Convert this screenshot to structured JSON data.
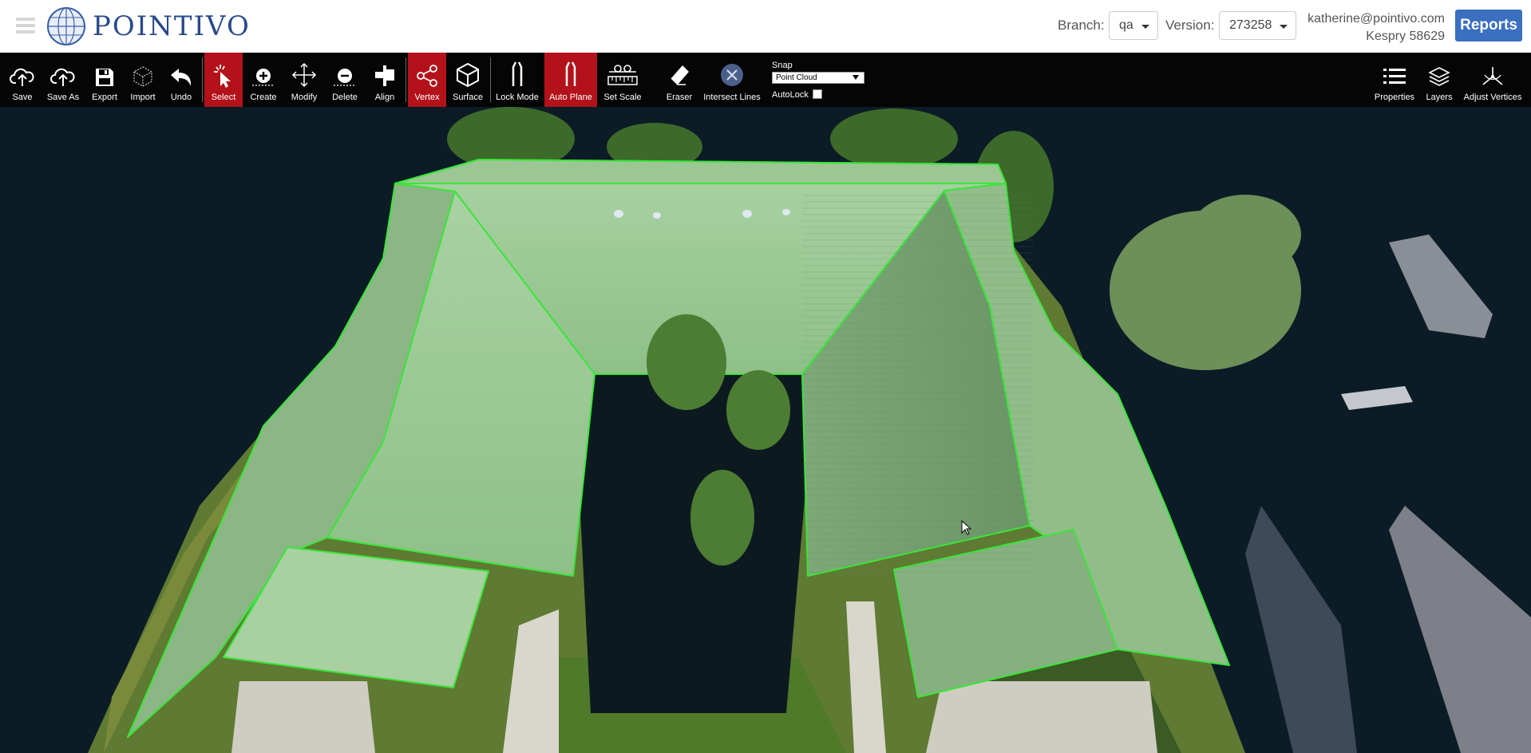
{
  "app": {
    "name": "POINTIVO"
  },
  "header": {
    "branch_label": "Branch:",
    "branch_value": "qa",
    "version_label": "Version:",
    "version_value": "273258",
    "user_email": "katherine@pointivo.com",
    "project_name": "Kespry 58629",
    "reports_label": "Reports"
  },
  "toolbar": {
    "tools": [
      {
        "id": "save",
        "label": "Save",
        "icon": "cloud-upload-icon",
        "active": false
      },
      {
        "id": "save-as",
        "label": "Save As",
        "icon": "cloud-upload-icon",
        "active": false
      },
      {
        "id": "export",
        "label": "Export",
        "icon": "floppy-disk-icon",
        "active": false
      },
      {
        "id": "import",
        "label": "Import",
        "icon": "wireframe-cube-icon",
        "active": false
      },
      {
        "id": "undo",
        "label": "Undo",
        "icon": "undo-arrow-icon",
        "active": false
      },
      {
        "id": "select",
        "label": "Select",
        "icon": "cursor-click-icon",
        "active": true
      },
      {
        "id": "create",
        "label": "Create",
        "icon": "plus-circle-icon",
        "active": false
      },
      {
        "id": "modify",
        "label": "Modify",
        "icon": "move-arrows-icon",
        "active": false
      },
      {
        "id": "delete",
        "label": "Delete",
        "icon": "minus-circle-icon",
        "active": false
      },
      {
        "id": "align",
        "label": "Align",
        "icon": "align-icon",
        "active": false
      },
      {
        "id": "vertex",
        "label": "Vertex",
        "icon": "share-nodes-icon",
        "active": true
      },
      {
        "id": "surface",
        "label": "Surface",
        "icon": "cube-icon",
        "active": false
      },
      {
        "id": "lock-mode",
        "label": "Lock Mode",
        "icon": "lock-plane-icon",
        "active": false
      },
      {
        "id": "auto-plane",
        "label": "Auto Plane",
        "icon": "auto-plane-icon",
        "active": true
      },
      {
        "id": "set-scale",
        "label": "Set Scale",
        "icon": "ruler-icon",
        "active": false
      },
      {
        "id": "eraser",
        "label": "Eraser",
        "icon": "eraser-icon",
        "active": false
      },
      {
        "id": "intersect-lines",
        "label": "Intersect Lines",
        "icon": "intersect-x-icon",
        "active": false
      }
    ],
    "snap": {
      "title": "Snap",
      "value": "Point Cloud",
      "autolock_label": "AutoLock",
      "autolock_checked": false
    },
    "right_tools": [
      {
        "id": "properties",
        "label": "Properties",
        "icon": "list-icon"
      },
      {
        "id": "layers",
        "label": "Layers",
        "icon": "layers-icon"
      },
      {
        "id": "adjust-vertices",
        "label": "Adjust Vertices",
        "icon": "tripod-icon"
      }
    ]
  },
  "colors": {
    "accent_active": "#b3121a",
    "reports_button": "#3b6fbf",
    "roof_outline": "#39e639",
    "roof_fill": "#9ccf9a"
  }
}
